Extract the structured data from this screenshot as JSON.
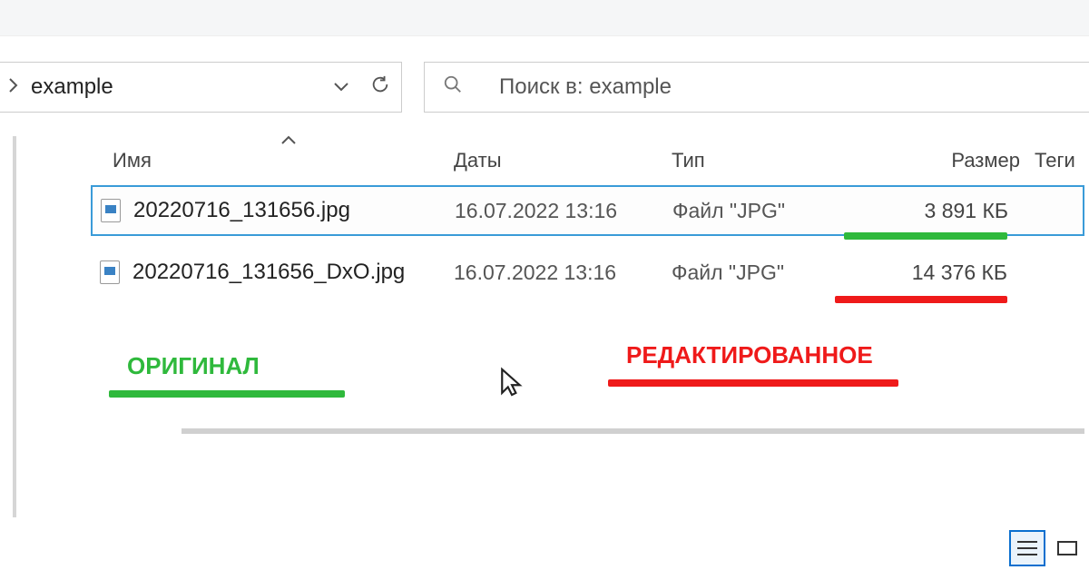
{
  "breadcrumb": {
    "current": "example"
  },
  "search": {
    "placeholder": "Поиск в: example"
  },
  "columns": {
    "name": "Имя",
    "date": "Даты",
    "type": "Тип",
    "size": "Размер",
    "tags": "Теги"
  },
  "files": [
    {
      "name": "20220716_131656.jpg",
      "date": "16.07.2022 13:16",
      "type": "Файл \"JPG\"",
      "size": "3 891 КБ"
    },
    {
      "name": "20220716_131656_DxO.jpg",
      "date": "16.07.2022 13:16",
      "type": "Файл \"JPG\"",
      "size": "14 376 КБ"
    }
  ],
  "annotations": {
    "original": "ОРИГИНАЛ",
    "edited": "РЕДАКТИРОВАННОЕ"
  },
  "colors": {
    "green": "#2fb93c",
    "red": "#ef1a1a",
    "selection": "#3a9bd8"
  }
}
